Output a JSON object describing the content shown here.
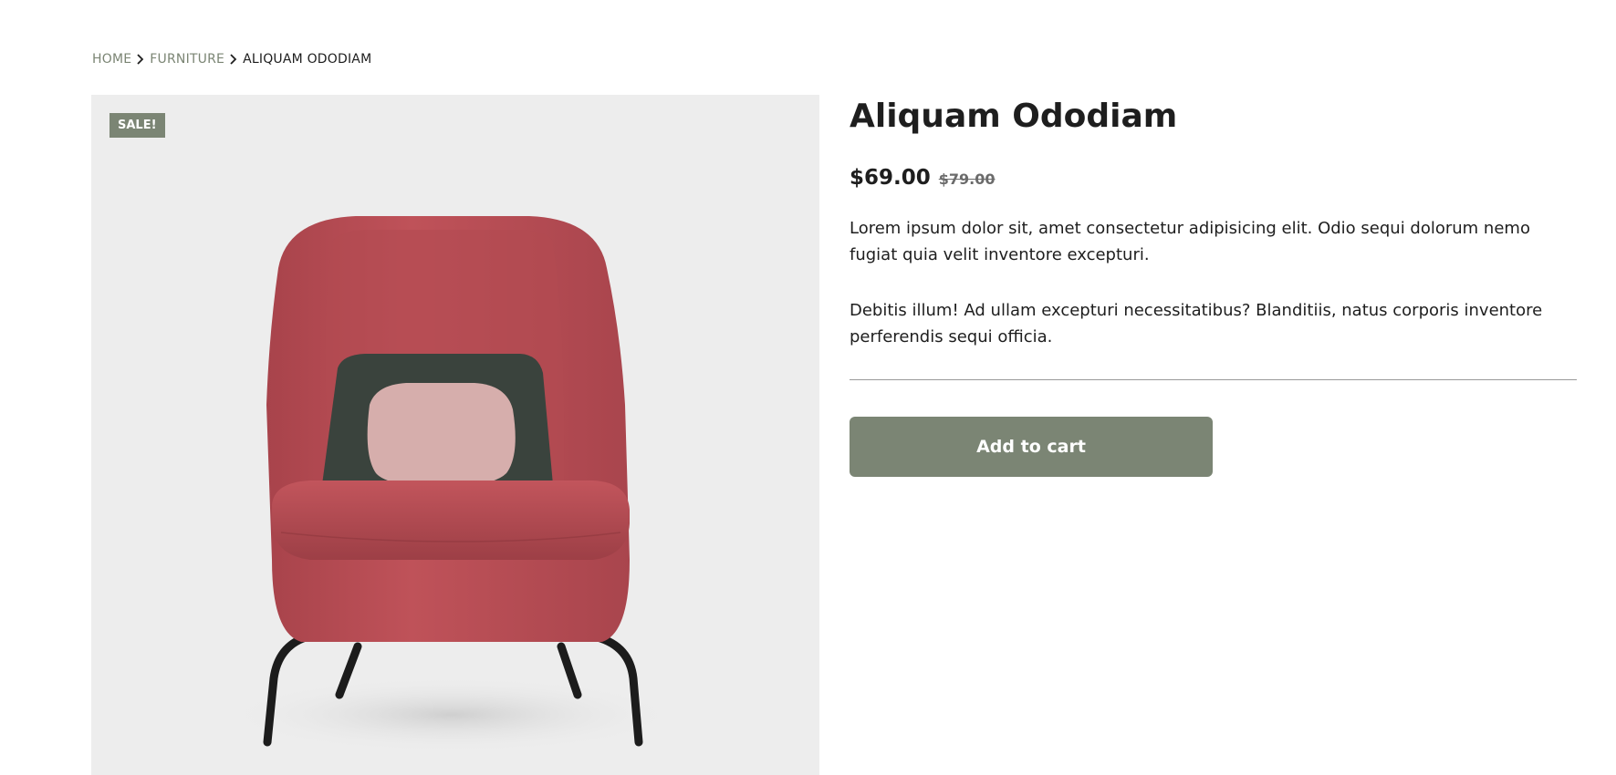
{
  "breadcrumb": {
    "home": "HOME",
    "category": "FURNITURE",
    "current": "ALIQUAM ODODIAM",
    "separator_icon": "chevron-right-icon"
  },
  "product": {
    "sale_badge": "SALE!",
    "title": "Aliquam Ododiam",
    "price_current": "$69.00",
    "price_regular": "$79.00",
    "description_1": "Lorem ipsum dolor sit, amet consectetur adipisicing elit. Odio sequi dolorum nemo fugiat quia velit inventore excepturi.",
    "description_2": "Debitis illum! Ad ullam excepturi necessitatibus? Blanditiis, natus corporis inventore perferendis sequi officia.",
    "add_to_cart_label": "Add to cart"
  },
  "colors": {
    "accent": "#7b8574",
    "text": "#1e1e1e",
    "image_background": "#ededed",
    "chair": "#b94d55",
    "cushion_dark": "#3a433d",
    "cushion_light": "#d6aeac"
  }
}
